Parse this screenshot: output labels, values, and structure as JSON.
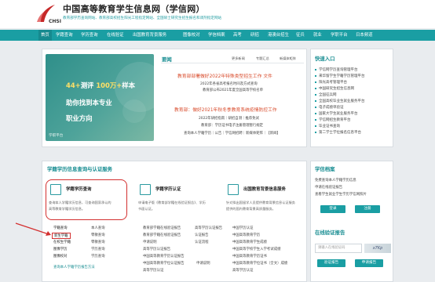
{
  "header": {
    "title": "中国高等教育学生信息网（学信网）",
    "subtitle": "教育部学历查询网站、教育部高校招生阳光工程指定网站、全国硕士研究生招生报名和调剂指定网站",
    "brand_en": "CHSI"
  },
  "nav": {
    "items": [
      "首页",
      "学籍查询",
      "学历查询",
      "在线验证",
      "出国教育背景服务",
      "图像校对",
      "学信档案",
      "高考",
      "研招",
      "港澳台招生",
      "征兵",
      "就业",
      "学职平台",
      "日本频道"
    ],
    "active_index": 0
  },
  "banner": {
    "line1_prefix": "44+",
    "line1_mid": "测评 ",
    "line1_num": "100万+",
    "line1_suffix": "样本",
    "line2": "助你找到本专业",
    "line3": "职业方向",
    "footer": "学职平台"
  },
  "news": {
    "title": "要闻",
    "links": [
      "更多新闻",
      "专题汇总",
      "新媒体矩阵"
    ],
    "headline1": "教育部部署做好2022年特殊类型招生工作 文件",
    "lines1": [
      "2022年各省高考报名时间及方式查询",
      "教育部公布2021年度全国高等学校名单"
    ],
    "headline2": "教育部：做好2021年秋冬季教育系统疫情防控工作",
    "lines2": [
      "2022年研招指南｜研招自测｜推荐免试",
      "教育部：学历证书电子注册管理暂行规定",
      "查询本人学籍学历｜公告｜学信网招聘｜新媒体矩阵｜【新闻】"
    ]
  },
  "quick_entry": {
    "title": "快速入口",
    "items": [
      "学信网学历查询管理平台",
      "来华留学生学籍学历管理平台",
      "阳光高考管理平台",
      "中国研究生招生信息网",
      "全国征兵网",
      "全国高校毕业生就业服务平台",
      "电子成绩单验证",
      "国家大学生就业服务平台",
      "学信网招生教育平台",
      "毕业证书查询",
      "第二学士学位报名信息平台"
    ]
  },
  "services": {
    "title": "学籍学历信息查询与认证服务",
    "cards": [
      {
        "title": "学籍学历查询",
        "desc1": "查询本人学籍学历信息，可查询国家承认的",
        "desc2": "高等教育学籍学历信息。"
      },
      {
        "title": "学籍学历认证",
        "desc1": "申请电子版《教育部学籍在线验证报告》、学历",
        "desc2": "书面认证。"
      },
      {
        "title": "出国教育背景信息服务",
        "desc1": "针对拟出国留学人员提供教育背景信息认证服务",
        "desc2": "提供的国内教育背景高质量服务。"
      }
    ],
    "col1": {
      "rows": [
        [
          "学籍查询",
          "本人查询"
        ],
        [
          "新生学籍",
          "零散查询"
        ],
        [
          "在校生学籍",
          "零散查询"
        ],
        [
          "图像学历",
          "学历查询"
        ],
        [
          "图像校对",
          "学历查询"
        ]
      ],
      "link": "查询本人学籍学历报告方法"
    },
    "col2": {
      "rows": [
        [
          "教育部学籍在线验证报告",
          "高等学历认证报告"
        ],
        [
          "教育部学籍在线验证报告",
          "认证报告"
        ],
        [
          "申请说明",
          "认证流程"
        ],
        [
          "高等学历认证报告",
          "中国高等教育学历认证报告"
        ],
        [
          "中国高等教育学位认证报告",
          "申请说明"
        ],
        [
          "高等学历认证"
        ]
      ]
    },
    "col3": {
      "rows": [
        [
          "中国学历认证"
        ],
        [
          "中国高等教育学历"
        ],
        [
          "中国高等教育学生成绩"
        ],
        [
          "中国高等学校学生入学考试成绩"
        ],
        [
          "中国高等教育学历证书"
        ],
        [
          "中国高等教育学位证书（全文）成绩"
        ],
        [
          "高等学历认证"
        ]
      ]
    }
  },
  "archive": {
    "title": "学信档案",
    "lines": [
      "免费查询本人学籍学历信息",
      "申请在线验证报告",
      "查看学生就业学生学历学信网照片"
    ],
    "buttons": [
      "登录",
      "注册"
    ]
  },
  "verify": {
    "title": "在线验证报告",
    "input_placeholder": "请输入在线验证码",
    "captcha_text": "x7Kp",
    "buttons": [
      "验证报告",
      "申请报告"
    ]
  },
  "colors": {
    "primary": "#1a9ea3",
    "highlight": "#d32f2f",
    "headline": "#d84a2a"
  }
}
